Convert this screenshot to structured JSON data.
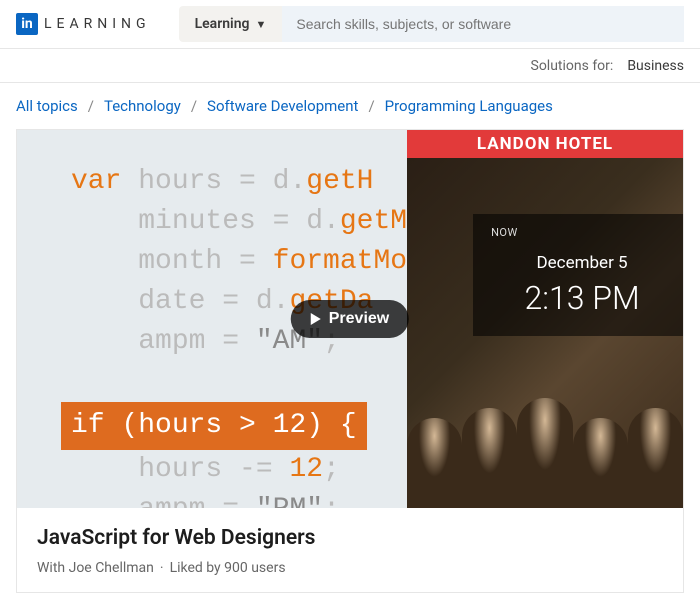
{
  "header": {
    "logo_text": "LEARNING",
    "dropdown_label": "Learning",
    "search_placeholder": "Search skills, subjects, or software"
  },
  "subbar": {
    "solutions_label": "Solutions for:",
    "business_label": "Business"
  },
  "breadcrumb": {
    "items": [
      "All topics",
      "Technology",
      "Software Development",
      "Programming Languages"
    ]
  },
  "preview": {
    "button_label": "Preview",
    "banner": "LANDON HOTEL",
    "clock": {
      "now_label": "NOW",
      "date": "December 5",
      "time": "2:13 PM"
    },
    "code": {
      "l1_kw": "var",
      "l1a": " hours = d.",
      "l1b": "getH",
      "l2a": "    minutes = d.",
      "l2b": "getM",
      "l3a": "    month = ",
      "l3b": "formatMo",
      "l4a": "    date = d.",
      "l4b": "getDa",
      "l5a": "    ampm = ",
      "l5b": "\"AM\"",
      "l5c": ";",
      "hl": "if (hours > 12) {",
      "l7a": "    hours -= ",
      "l7b": "12",
      "l7c": ";",
      "l8a": "    ampm = ",
      "l8b": "\"PM\"",
      "l8c": ";"
    }
  },
  "course": {
    "title": "JavaScript for Web Designers",
    "author_prefix": "With ",
    "author": "Joe Chellman",
    "likes": "Liked by 900 users"
  }
}
